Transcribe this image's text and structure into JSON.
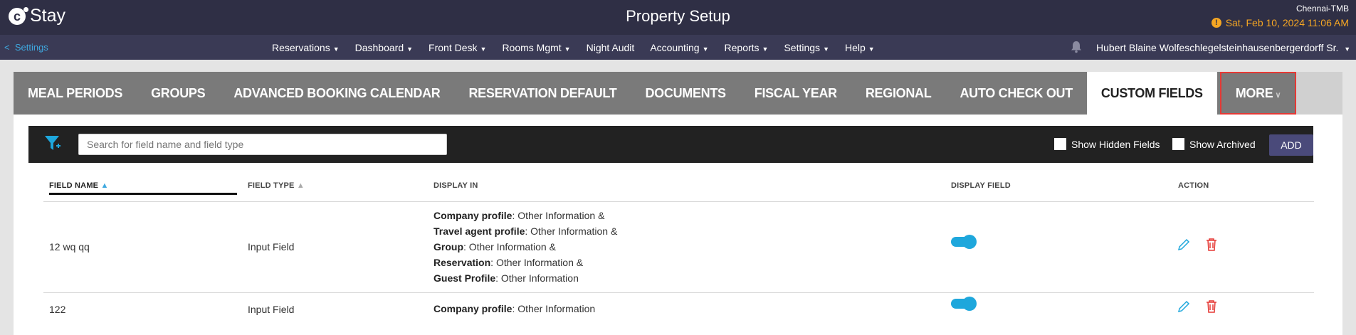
{
  "app": {
    "logo_letter": "c",
    "logo_text": "Stay",
    "page_title": "Property Setup"
  },
  "status": {
    "property": "Chennai-TMB",
    "datetime": "Sat, Feb 10, 2024 11:06 AM",
    "warning_symbol": "!"
  },
  "nav": {
    "back_label": "Settings",
    "back_symbol": "<",
    "items": [
      "Reservations",
      "Dashboard",
      "Front Desk",
      "Rooms Mgmt",
      "Night Audit",
      "Accounting",
      "Reports",
      "Settings",
      "Help"
    ],
    "has_caret": [
      true,
      true,
      true,
      true,
      false,
      true,
      true,
      true,
      true
    ],
    "user": "Hubert Blaine Wolfeschlegelsteinhausenbergerdorff Sr."
  },
  "tabs": {
    "items": [
      "MEAL PERIODS",
      "GROUPS",
      "ADVANCED BOOKING CALENDAR",
      "RESERVATION DEFAULT",
      "DOCUMENTS",
      "FISCAL YEAR",
      "REGIONAL",
      "AUTO CHECK OUT",
      "CUSTOM FIELDS"
    ],
    "active": "CUSTOM FIELDS",
    "more": "MORE"
  },
  "toolbar": {
    "search_placeholder": "Search for field name and field type",
    "show_hidden": "Show Hidden Fields",
    "show_archived": "Show Archived",
    "add": "ADD"
  },
  "table": {
    "headers": {
      "field_name": "FIELD NAME",
      "field_type": "FIELD TYPE",
      "display_in": "DISPLAY IN",
      "display_field": "DISPLAY FIELD",
      "action": "ACTION"
    },
    "rows": [
      {
        "field_name": "12 wq qq",
        "field_type": "Input Field",
        "display_in": [
          {
            "label": "Company profile",
            "value": "Other Information &"
          },
          {
            "label": "Travel agent profile",
            "value": "Other Information &"
          },
          {
            "label": "Group",
            "value": "Other Information &"
          },
          {
            "label": "Reservation",
            "value": "Other Information &"
          },
          {
            "label": "Guest Profile",
            "value": "Other Information"
          }
        ],
        "display_field_on": true
      },
      {
        "field_name": "122",
        "field_type": "Input Field",
        "display_in": [
          {
            "label": "Company profile",
            "value": "Other Information"
          }
        ],
        "display_field_on": true
      }
    ]
  },
  "colors": {
    "topbar": "#2f2f45",
    "navbar": "#3a3a55",
    "accent": "#1ea7dc",
    "delete": "#e53935",
    "warning": "#f5a623"
  }
}
